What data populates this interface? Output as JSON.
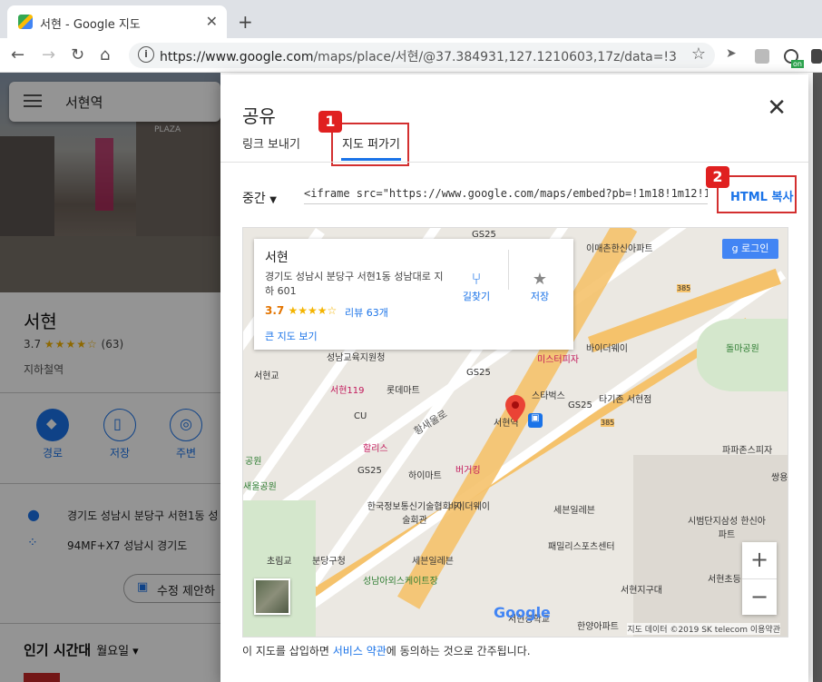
{
  "browser": {
    "tab_title": "서현 - Google 지도",
    "new_tab": "+",
    "url_host": "https://www.google.com",
    "url_path": "/maps/place/서현/@37.384931,127.1210603,17z/data=!3m1!4b1...",
    "ext_badge": "on"
  },
  "side": {
    "search_query": "서현역",
    "photo_sign": "PLAZA",
    "place_name": "서현",
    "rating": "3.7",
    "stars": "★★★★☆",
    "reviews": "(63)",
    "type": "지하철역",
    "actions": [
      {
        "label": "경로",
        "icon": "directions-icon"
      },
      {
        "label": "저장",
        "icon": "bookmark-icon"
      },
      {
        "label": "주변",
        "icon": "nearby-icon"
      }
    ],
    "address": "경기도 성남시 분당구 서현1동 성",
    "plus_code": "94MF+X7 성남시 경기도",
    "suggest_edit": "수정 제안하",
    "popular_times": "인기 시간대",
    "day": "월요일"
  },
  "dialog": {
    "title": "공유",
    "tab_send_link": "링크 보내기",
    "tab_embed": "지도 퍼가기",
    "size_label": "중간",
    "iframe_code": "<iframe src=\"https://www.google.com/maps/embed?pb=!1m18!1m12!1m3!1d",
    "copy_html": "HTML 복사",
    "badge1": "1",
    "badge2": "2",
    "legal_prefix": "이 지도를 삽입하면 ",
    "legal_link": "서비스 약관",
    "legal_suffix": "에 동의하는 것으로 간주됩니다."
  },
  "map": {
    "card": {
      "title": "서현",
      "address": "경기도 성남시 분당구 서현1동 성남대로 지하 601",
      "rating": "3.7",
      "stars": "★★★★☆",
      "reviews": "리뷰 63개",
      "directions": "길찾기",
      "save": "저장",
      "big_map": "큰 지도 보기"
    },
    "login": "로그인",
    "footer": "지도 데이터 ©2019 SK telecom 이용약관",
    "google": "Google",
    "zoom_in": "+",
    "zoom_out": "−",
    "labels": [
      {
        "t": "GS25"
      },
      {
        "t": "이매촌한신아파트"
      },
      {
        "t": "385"
      },
      {
        "t": "돌마공원"
      },
      {
        "t": "미스터피자"
      },
      {
        "t": "바이더웨이"
      },
      {
        "t": "서현교"
      },
      {
        "t": "성남교육지원청"
      },
      {
        "t": "GS25"
      },
      {
        "t": "서현119"
      },
      {
        "t": "롯데마트"
      },
      {
        "t": "스타벅스"
      },
      {
        "t": "타기존 서현점"
      },
      {
        "t": "CU"
      },
      {
        "t": "황새울로"
      },
      {
        "t": "서현역"
      },
      {
        "t": "GS25"
      },
      {
        "t": "385"
      },
      {
        "t": "할리스"
      },
      {
        "t": "파파존스피자"
      },
      {
        "t": "하이마트"
      },
      {
        "t": "버거킹"
      },
      {
        "t": "GS25"
      },
      {
        "t": "쌍용"
      },
      {
        "t": "새울공원"
      },
      {
        "t": "한국정보통신기술협회 기술회관"
      },
      {
        "t": "바이더웨이"
      },
      {
        "t": "세븐일레븐"
      },
      {
        "t": "시범단지삼성 한신아파트"
      },
      {
        "t": "패밀리스포츠센터"
      },
      {
        "t": "초림교"
      },
      {
        "t": "분당구청"
      },
      {
        "t": "세븐일레븐"
      },
      {
        "t": "서현초등"
      },
      {
        "t": "성남아외스케이트장"
      },
      {
        "t": "서현지구대"
      },
      {
        "t": "서현중학교"
      },
      {
        "t": "한양아파트"
      },
      {
        "t": "공원"
      }
    ]
  }
}
